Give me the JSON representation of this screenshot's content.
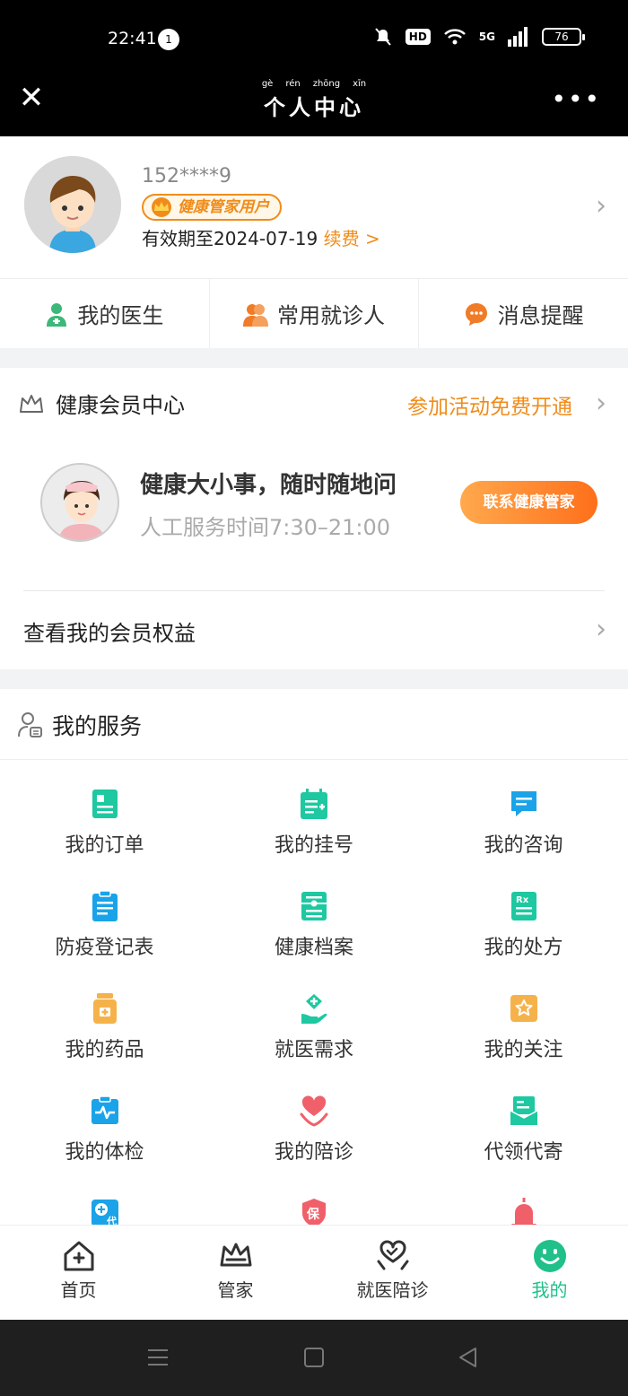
{
  "status_bar": {
    "time": "22:41",
    "notification_count": "1",
    "hd": "HD",
    "network": "5G",
    "battery": "76"
  },
  "header": {
    "title": "个人中心",
    "pinyin": [
      "gè",
      "rén",
      "zhōng",
      "xīn"
    ],
    "close_icon": "close-icon",
    "more_icon": "more-icon"
  },
  "profile": {
    "phone": "152****9",
    "badge": "健康管家用户",
    "expire": "有效期至2024-07-19",
    "renew": "续费 >"
  },
  "shortcuts": [
    {
      "label": "我的医生",
      "icon": "doctor-icon",
      "color": "#3cb878"
    },
    {
      "label": "常用就诊人",
      "icon": "patients-icon",
      "color": "#f07c28"
    },
    {
      "label": "消息提醒",
      "icon": "message-icon",
      "color": "#f07c28"
    }
  ],
  "member": {
    "title": "健康会员中心",
    "promo": "参加活动免费开通",
    "slogan": "健康大小事，随时随地问",
    "service_time": "人工服务时间7:30–21:00",
    "contact_button": "联系健康管家",
    "benefits": "查看我的会员权益"
  },
  "services": {
    "title": "我的服务",
    "items": [
      {
        "label": "我的订单",
        "icon": "order-icon",
        "color": "#1ec8a0"
      },
      {
        "label": "我的挂号",
        "icon": "calendar-icon",
        "color": "#1ec8a0"
      },
      {
        "label": "我的咨询",
        "icon": "chat-icon",
        "color": "#1aa3e8"
      },
      {
        "label": "防疫登记表",
        "icon": "clipboard-icon",
        "color": "#1aa3e8"
      },
      {
        "label": "健康档案",
        "icon": "archive-icon",
        "color": "#1ec8a0"
      },
      {
        "label": "我的处方",
        "icon": "prescription-icon",
        "color": "#1ec8a0"
      },
      {
        "label": "我的药品",
        "icon": "medicine-icon",
        "color": "#f6b24a"
      },
      {
        "label": "就医需求",
        "icon": "medical-hand-icon",
        "color": "#1ec8a0"
      },
      {
        "label": "我的关注",
        "icon": "star-icon",
        "color": "#f6b24a"
      },
      {
        "label": "我的体检",
        "icon": "checkup-icon",
        "color": "#1aa3e8"
      },
      {
        "label": "我的陪诊",
        "icon": "heart-icon",
        "color": "#f0606a"
      },
      {
        "label": "代领代寄",
        "icon": "mail-icon",
        "color": "#1ec8a0"
      }
    ],
    "partial_row": [
      {
        "icon": "proxy-icon",
        "color": "#1aa3e8",
        "text": "代"
      },
      {
        "icon": "shield-icon",
        "color": "#f0606a",
        "text": "保"
      },
      {
        "icon": "alarm-icon",
        "color": "#f0606a"
      }
    ]
  },
  "bottom_nav": [
    {
      "label": "首页",
      "icon": "home-icon"
    },
    {
      "label": "管家",
      "icon": "crown-icon"
    },
    {
      "label": "就医陪诊",
      "icon": "hands-heart-icon"
    },
    {
      "label": "我的",
      "icon": "smile-icon",
      "active": true
    }
  ],
  "colors": {
    "accent": "#20c08a",
    "orange": "#f08c1a",
    "header_bg": "#000000"
  }
}
